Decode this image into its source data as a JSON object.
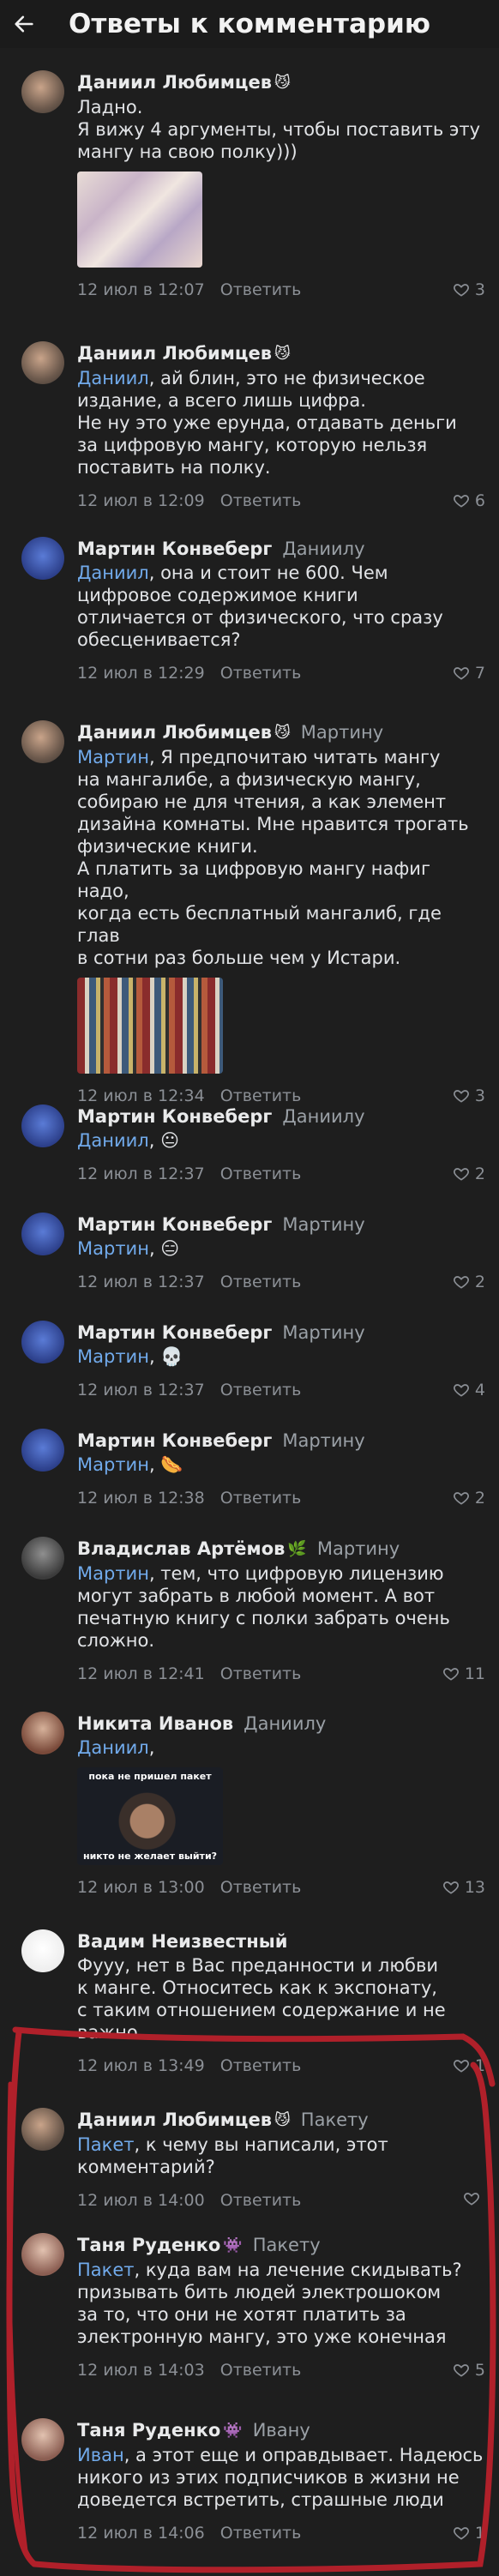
{
  "header": {
    "title": "Ответы к комментарию",
    "back_icon": "arrow-left-icon"
  },
  "reply_label": "Ответить",
  "comments": [
    {
      "author": "Даниил Любимцев",
      "badge": "😼",
      "reply_to": "",
      "mention": "",
      "text_lines": [
        "Ладно.",
        "Я вижу 4 аргументы, чтобы поставить эту",
        "мангу на свою полку)))"
      ],
      "time": "12 июл в 12:07",
      "likes": "3"
    },
    {
      "author": "Даниил Любимцев",
      "badge": "😼",
      "reply_to": "",
      "mention": "Даниил",
      "text_lines": [
        ", ай блин, это не физическое",
        "издание, а всего лишь цифра.",
        "Не ну это уже ерунда, отдавать деньги",
        "за цифровую мангу, которую нельзя",
        "поставить на полку."
      ],
      "time": "12 июл в 12:09",
      "likes": "6"
    },
    {
      "author": "Мартин Конвеберг",
      "badge": "",
      "reply_to": "Даниилу",
      "mention": "Даниил",
      "text_lines": [
        ",  она и стоит не 600. Чем",
        "цифровое содержимое книги",
        "отличается от физического, что сразу",
        "обесценивается?"
      ],
      "time": "12 июл в 12:29",
      "likes": "7"
    },
    {
      "author": "Даниил Любимцев",
      "badge": "😼",
      "reply_to": "Мартину",
      "mention": "Мартин",
      "text_lines": [
        ", Я предпочитаю читать мангу",
        "на мангалибе, а физическую мангу,",
        "собираю не для чтения, а как элемент",
        "дизайна комнаты. Мне нравится трогать",
        "физические книги.",
        "А платить за цифровую мангу нафиг надо,",
        "когда есть бесплатный мангалиб, где глав",
        "в сотни раз больше чем у Истари."
      ],
      "time": "12 июл в 12:34",
      "likes": "3"
    },
    {
      "author": "Мартин Конвеберг",
      "badge": "",
      "reply_to": "Даниилу",
      "mention": "Даниил",
      "text_lines": [
        ", 😐"
      ],
      "time": "12 июл в 12:37",
      "likes": "2"
    },
    {
      "author": "Мартин Конвеберг",
      "badge": "",
      "reply_to": "Мартину",
      "mention": "Мартин",
      "text_lines": [
        ", 😑"
      ],
      "time": "12 июл в 12:37",
      "likes": "2"
    },
    {
      "author": "Мартин Конвеберг",
      "badge": "",
      "reply_to": "Мартину",
      "mention": "Мартин",
      "text_lines": [
        ", 💀"
      ],
      "time": "12 июл в 12:37",
      "likes": "4"
    },
    {
      "author": "Мартин Конвеберг",
      "badge": "",
      "reply_to": "Мартину",
      "mention": "Мартин",
      "text_lines": [
        ", 🌭"
      ],
      "time": "12 июл в 12:38",
      "likes": "2"
    },
    {
      "author": "Владислав Артёмов",
      "badge": "🌿",
      "reply_to": "Мартину",
      "mention": "Мартин",
      "text_lines": [
        ", тем, что цифровую лицензию",
        "могут забрать в любой момент. А вот",
        "печатную книгу с полки забрать очень",
        "сложно."
      ],
      "time": "12 июл в 12:41",
      "likes": "11"
    },
    {
      "author": "Никита Иванов",
      "badge": "",
      "reply_to": "Даниилу",
      "mention": "Даниил",
      "text_lines": [
        ","
      ],
      "image_caption_top": "пока не пришел пакет",
      "image_caption_bottom": "никто не желает выйти?",
      "time": "12 июл в 13:00",
      "likes": "13"
    },
    {
      "author": "Вадим Неизвестный",
      "badge": "",
      "reply_to": "",
      "mention": "",
      "text_lines": [
        "Фууу, нет в Вас преданности и любви",
        "к манге. Относитесь как к экспонату,",
        "с таким отношением содержание и не",
        "важно."
      ],
      "time": "12 июл в 13:49",
      "likes": "1"
    },
    {
      "author": "Даниил Любимцев",
      "badge": "😼",
      "reply_to": "Пакету",
      "mention": "Пакет",
      "text_lines": [
        ", к чему вы написали, этот",
        "комментарий?"
      ],
      "time": "12 июл в 14:00",
      "likes": ""
    },
    {
      "author": "Таня Руденко",
      "badge": "👾",
      "reply_to": "Пакету",
      "mention": "Пакет",
      "text_lines": [
        ", куда вам на лечение скидывать?",
        "призывать бить людей электрошоком",
        "за то, что они не хотят платить за",
        "электронную мангу, это уже конечная"
      ],
      "time": "12 июл в 14:03",
      "likes": "5"
    },
    {
      "author": "Таня Руденко",
      "badge": "👾",
      "reply_to": "Ивану",
      "mention": "Иван",
      "text_lines": [
        ", а этот еще и оправдывает. Надеюсь",
        "никого из этих подписчиков в жизни не",
        "доведется встретить, страшные люди"
      ],
      "time": "12 июл в 14:06",
      "likes": "1"
    }
  ]
}
